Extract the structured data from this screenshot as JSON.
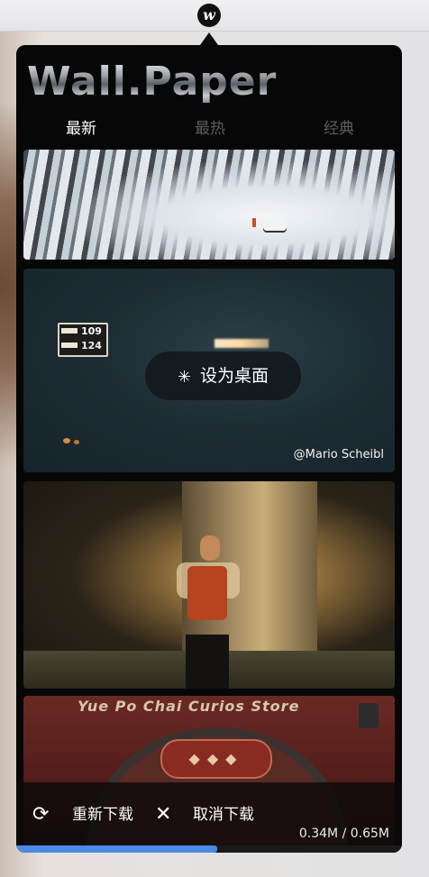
{
  "menubar": {
    "app_icon_glyph": "w",
    "app_icon_name": "wallpaper-app-icon"
  },
  "app": {
    "logo_text": "Wall.Paper"
  },
  "tabs": [
    {
      "label": "最新",
      "active": true
    },
    {
      "label": "最热",
      "active": false
    },
    {
      "label": "经典",
      "active": false
    }
  ],
  "wallpapers": [
    {
      "name": "snowy-forest"
    },
    {
      "name": "night-gas-station",
      "sign_price_1": "109",
      "sign_price_2": "124",
      "action_label": "设为桌面",
      "action_icon": "loading-spinner-icon",
      "credit": "@Mario Scheibl"
    },
    {
      "name": "person-under-tree"
    },
    {
      "name": "curio-store",
      "store_sign": "Yue Po Chai Curios Store"
    }
  ],
  "download": {
    "retry_label": "重新下载",
    "retry_icon": "refresh-icon",
    "cancel_label": "取消下载",
    "cancel_icon": "close-icon",
    "size_text": "0.34M / 0.65M",
    "progress_fraction": 0.52,
    "progress_color": "#4a8be6"
  }
}
